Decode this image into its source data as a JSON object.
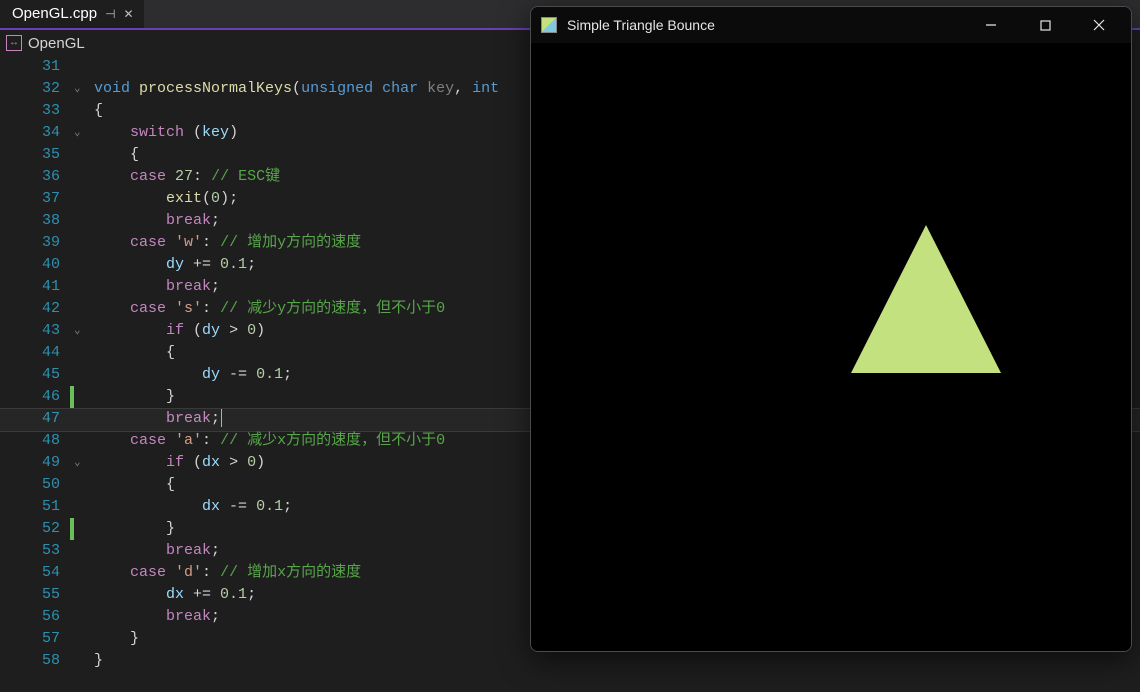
{
  "tab": {
    "filename": "OpenGL.cpp",
    "pin_glyph": "⊣",
    "close_glyph": "✕"
  },
  "breadcrumb": {
    "icon_glyph": "↔",
    "project": "OpenGL"
  },
  "editor": {
    "line_start": 31,
    "line_end": 58,
    "changed_lines": [
      45,
      51
    ],
    "highlighted_line": 47,
    "foldable_lines": [
      32,
      34,
      43,
      49
    ],
    "lines": {
      "31": {
        "tokens": []
      },
      "32": {
        "tokens": [
          {
            "t": "kw",
            "v": "void "
          },
          {
            "t": "fn",
            "v": "processNormalKeys"
          },
          {
            "t": "punc",
            "v": "("
          },
          {
            "t": "kw",
            "v": "unsigned char "
          },
          {
            "t": "grey",
            "v": "key"
          },
          {
            "t": "punc",
            "v": ", "
          },
          {
            "t": "kw",
            "v": "int"
          }
        ]
      },
      "33": {
        "tokens": [
          {
            "t": "brace",
            "v": "{"
          }
        ]
      },
      "34": {
        "indent": 1,
        "tokens": [
          {
            "t": "kw2",
            "v": "switch "
          },
          {
            "t": "punc",
            "v": "("
          },
          {
            "t": "id",
            "v": "key"
          },
          {
            "t": "punc",
            "v": ")"
          }
        ]
      },
      "35": {
        "indent": 1,
        "tokens": [
          {
            "t": "brace",
            "v": "{"
          }
        ]
      },
      "36": {
        "indent": 1,
        "tokens": [
          {
            "t": "kw2",
            "v": "case "
          },
          {
            "t": "num",
            "v": "27"
          },
          {
            "t": "punc",
            "v": ": "
          },
          {
            "t": "cmt",
            "v": "// ESC键"
          }
        ]
      },
      "37": {
        "indent": 2,
        "tokens": [
          {
            "t": "fn",
            "v": "exit"
          },
          {
            "t": "punc",
            "v": "("
          },
          {
            "t": "num",
            "v": "0"
          },
          {
            "t": "punc",
            "v": ");"
          }
        ]
      },
      "38": {
        "indent": 2,
        "tokens": [
          {
            "t": "kw2",
            "v": "break"
          },
          {
            "t": "punc",
            "v": ";"
          }
        ]
      },
      "39": {
        "indent": 1,
        "tokens": [
          {
            "t": "kw2",
            "v": "case "
          },
          {
            "t": "str",
            "v": "'w'"
          },
          {
            "t": "punc",
            "v": ": "
          },
          {
            "t": "cmt",
            "v": "// 增加y方向的速度"
          }
        ]
      },
      "40": {
        "indent": 2,
        "tokens": [
          {
            "t": "id",
            "v": "dy "
          },
          {
            "t": "punc",
            "v": "+= "
          },
          {
            "t": "num",
            "v": "0.1"
          },
          {
            "t": "punc",
            "v": ";"
          }
        ]
      },
      "41": {
        "indent": 2,
        "tokens": [
          {
            "t": "kw2",
            "v": "break"
          },
          {
            "t": "punc",
            "v": ";"
          }
        ]
      },
      "42": {
        "indent": 1,
        "tokens": [
          {
            "t": "kw2",
            "v": "case "
          },
          {
            "t": "str",
            "v": "'s'"
          },
          {
            "t": "punc",
            "v": ": "
          },
          {
            "t": "cmt",
            "v": "// 减少y方向的速度，但不小于0"
          }
        ]
      },
      "43": {
        "indent": 2,
        "tokens": [
          {
            "t": "kw2",
            "v": "if "
          },
          {
            "t": "punc",
            "v": "("
          },
          {
            "t": "id",
            "v": "dy "
          },
          {
            "t": "punc",
            "v": "> "
          },
          {
            "t": "num",
            "v": "0"
          },
          {
            "t": "punc",
            "v": ")"
          }
        ]
      },
      "44": {
        "indent": 2,
        "tokens": [
          {
            "t": "brace",
            "v": "{"
          }
        ]
      },
      "45": {
        "indent": 3,
        "tokens": [
          {
            "t": "id",
            "v": "dy "
          },
          {
            "t": "punc",
            "v": "-= "
          },
          {
            "t": "num",
            "v": "0.1"
          },
          {
            "t": "punc",
            "v": ";"
          }
        ]
      },
      "46": {
        "indent": 2,
        "tokens": [
          {
            "t": "brace",
            "v": "}"
          }
        ]
      },
      "47": {
        "indent": 2,
        "tokens": [
          {
            "t": "kw2",
            "v": "break"
          },
          {
            "t": "punc",
            "v": ";"
          }
        ],
        "caret": true
      },
      "48": {
        "indent": 1,
        "tokens": [
          {
            "t": "kw2",
            "v": "case "
          },
          {
            "t": "str",
            "v": "'a'"
          },
          {
            "t": "punc",
            "v": ": "
          },
          {
            "t": "cmt",
            "v": "// 减少x方向的速度，但不小于0"
          }
        ]
      },
      "49": {
        "indent": 2,
        "tokens": [
          {
            "t": "kw2",
            "v": "if "
          },
          {
            "t": "punc",
            "v": "("
          },
          {
            "t": "id",
            "v": "dx "
          },
          {
            "t": "punc",
            "v": "> "
          },
          {
            "t": "num",
            "v": "0"
          },
          {
            "t": "punc",
            "v": ")"
          }
        ]
      },
      "50": {
        "indent": 2,
        "tokens": [
          {
            "t": "brace",
            "v": "{"
          }
        ]
      },
      "51": {
        "indent": 3,
        "tokens": [
          {
            "t": "id",
            "v": "dx "
          },
          {
            "t": "punc",
            "v": "-= "
          },
          {
            "t": "num",
            "v": "0.1"
          },
          {
            "t": "punc",
            "v": ";"
          }
        ]
      },
      "52": {
        "indent": 2,
        "tokens": [
          {
            "t": "brace",
            "v": "}"
          }
        ]
      },
      "53": {
        "indent": 2,
        "tokens": [
          {
            "t": "kw2",
            "v": "break"
          },
          {
            "t": "punc",
            "v": ";"
          }
        ]
      },
      "54": {
        "indent": 1,
        "tokens": [
          {
            "t": "kw2",
            "v": "case "
          },
          {
            "t": "str",
            "v": "'d'"
          },
          {
            "t": "punc",
            "v": ": "
          },
          {
            "t": "cmt",
            "v": "// 增加x方向的速度"
          }
        ]
      },
      "55": {
        "indent": 2,
        "tokens": [
          {
            "t": "id",
            "v": "dx "
          },
          {
            "t": "punc",
            "v": "+= "
          },
          {
            "t": "num",
            "v": "0.1"
          },
          {
            "t": "punc",
            "v": ";"
          }
        ]
      },
      "56": {
        "indent": 2,
        "tokens": [
          {
            "t": "kw2",
            "v": "break"
          },
          {
            "t": "punc",
            "v": ";"
          }
        ]
      },
      "57": {
        "indent": 1,
        "tokens": [
          {
            "t": "brace",
            "v": "}"
          }
        ]
      },
      "58": {
        "tokens": [
          {
            "t": "brace",
            "v": "}"
          }
        ]
      }
    }
  },
  "output_window": {
    "title": "Simple Triangle Bounce",
    "triangle_color": "#c4e17f",
    "background_color": "#000000"
  }
}
